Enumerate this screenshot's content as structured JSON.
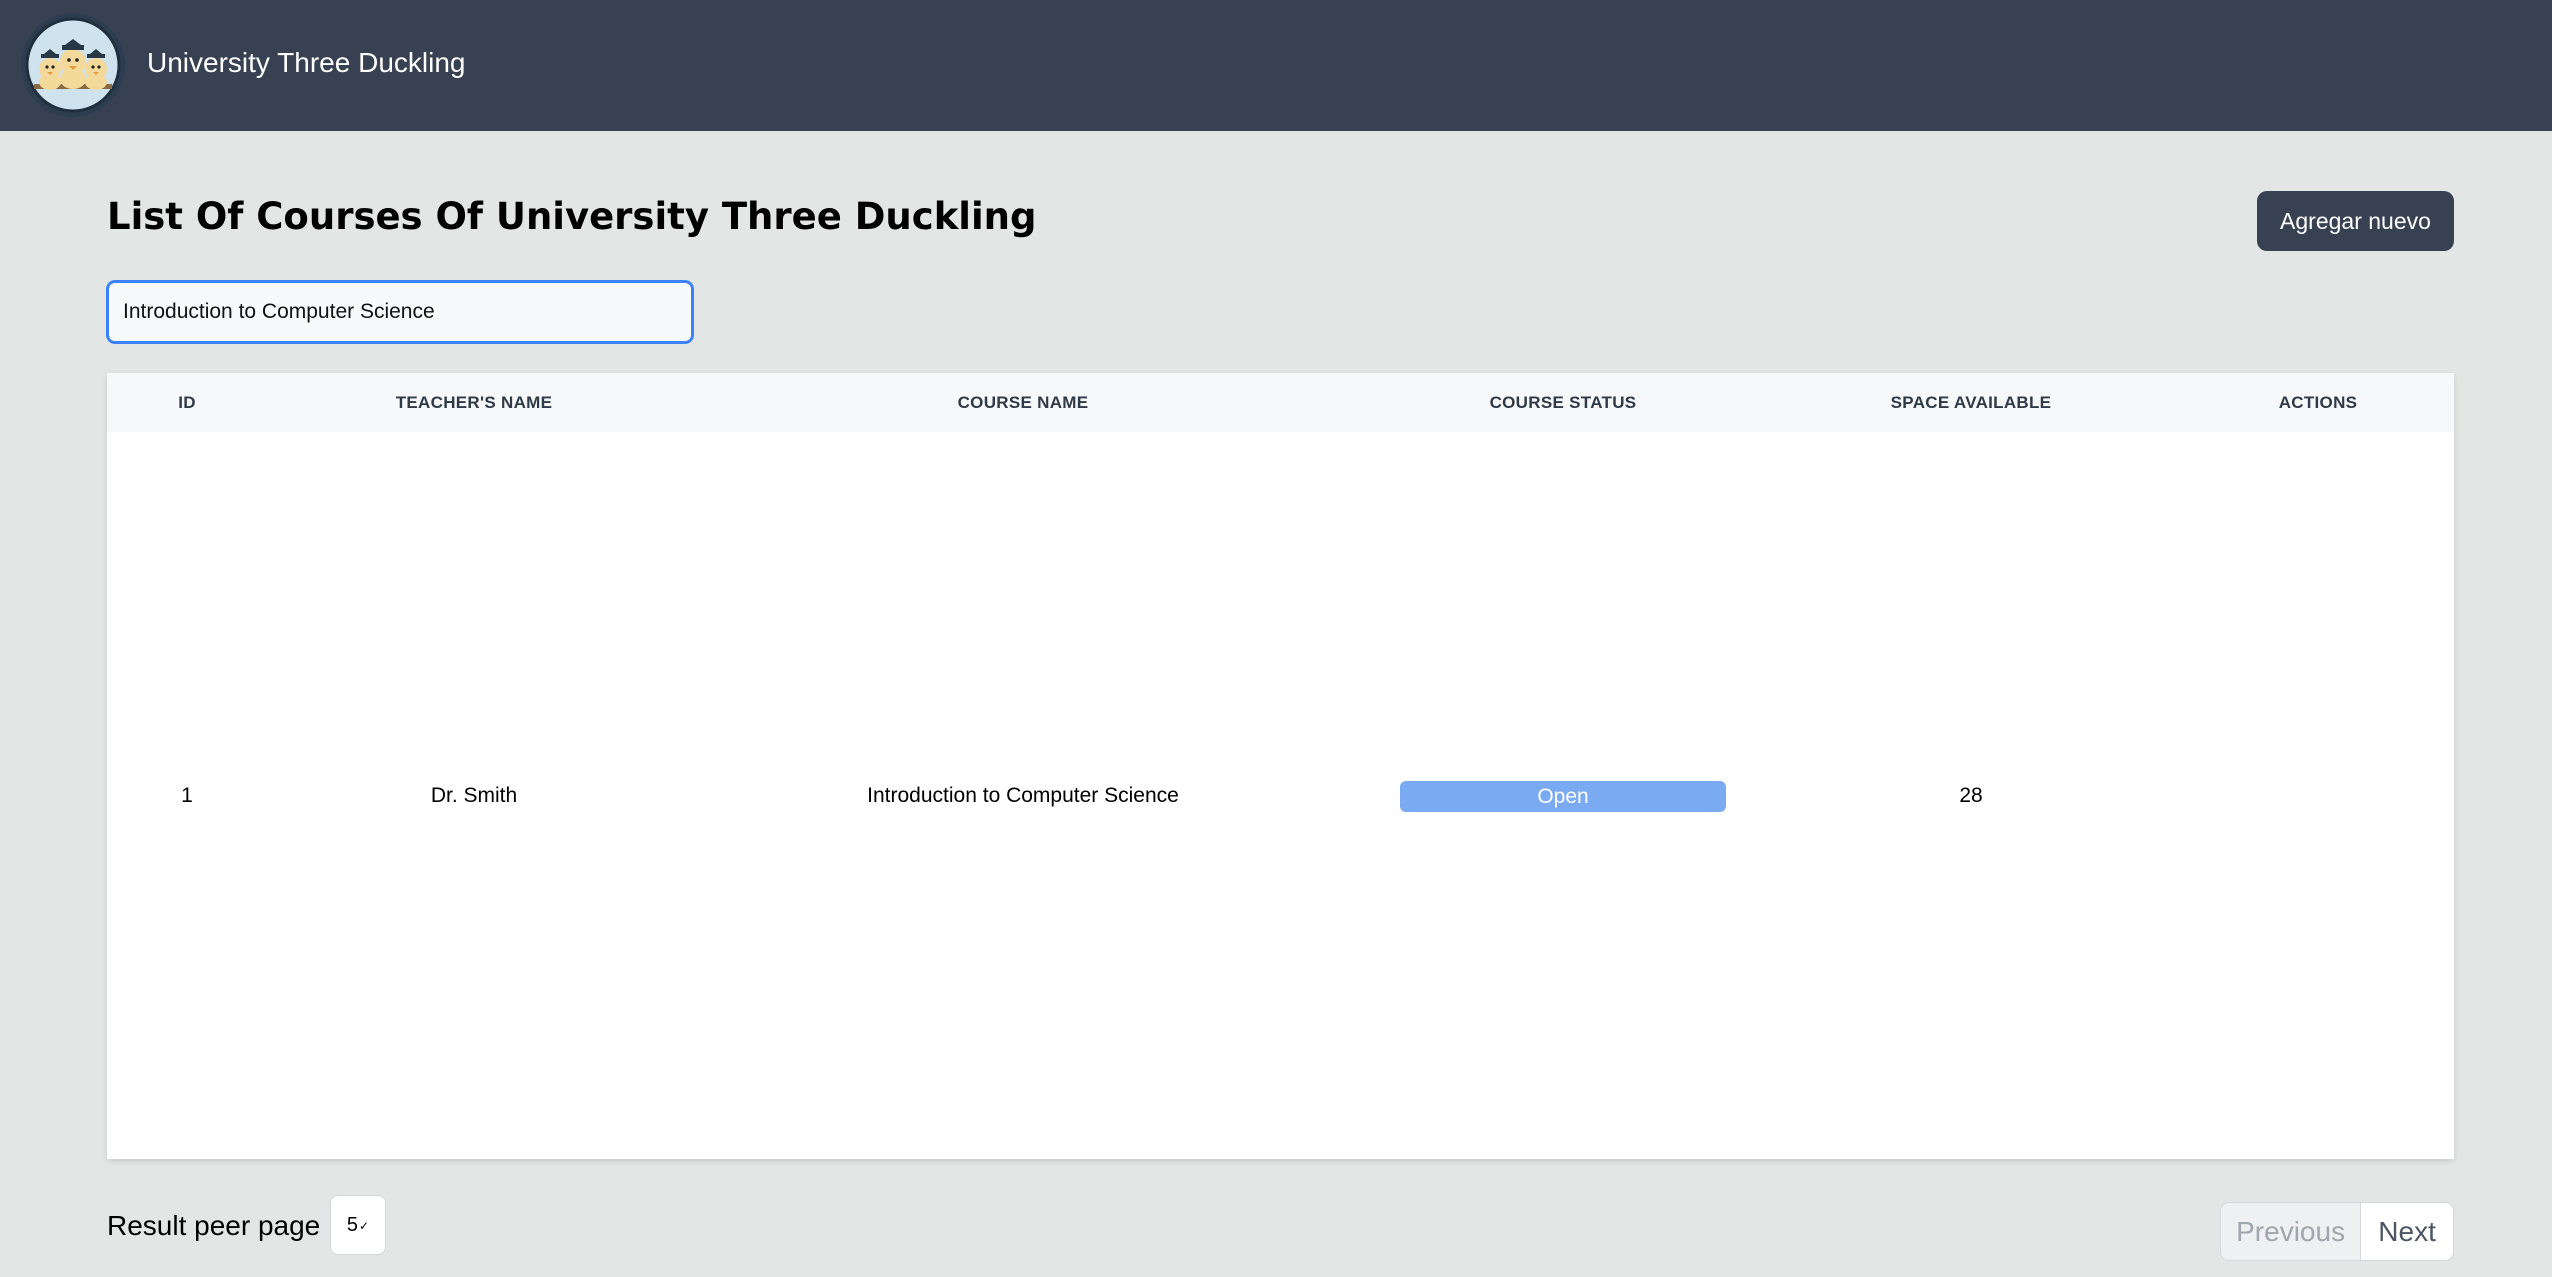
{
  "header": {
    "brand": "University Three Duckling",
    "logo_icon": "duckling-graduates-logo"
  },
  "page": {
    "title": "List Of Courses Of University Three Duckling",
    "add_button_label": "Agregar nuevo"
  },
  "search": {
    "value": "Introduction to Computer Science"
  },
  "table": {
    "columns": [
      "ID",
      "TEACHER'S NAME",
      "COURSE NAME",
      "COURSE STATUS",
      "SPACE AVAILABLE",
      "ACTIONS"
    ],
    "rows": [
      {
        "id": "1",
        "teacher": "Dr. Smith",
        "course": "Introduction to Computer Science",
        "status": "Open",
        "space": "28",
        "actions": ""
      }
    ]
  },
  "footer": {
    "results_label": "Result peer page",
    "results_per_page": "5",
    "previous_label": "Previous",
    "next_label": "Next"
  },
  "colors": {
    "header_bg": "#374151",
    "page_bg": "#e4e6e5",
    "accent": "#3b82f6",
    "status_open": "#7aaaf2"
  }
}
